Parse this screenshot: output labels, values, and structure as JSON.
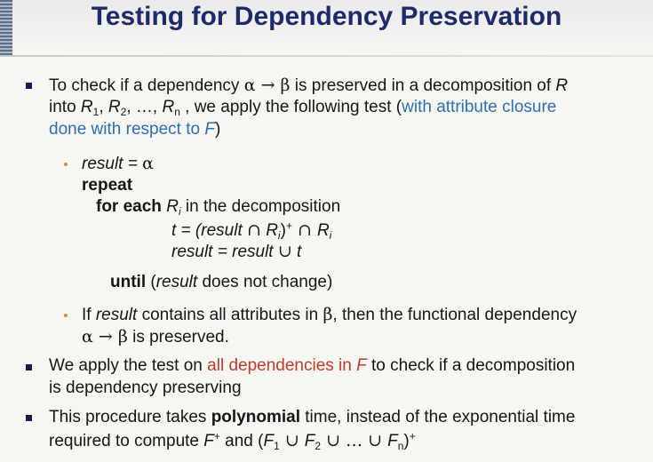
{
  "slide": {
    "title": "Testing for Dependency Preservation"
  },
  "b1": {
    "l1_a": "To check if a dependency ",
    "alpha": "α",
    "arrow": " → ",
    "beta": "β",
    "l1_b": " is preserved in a decomposition of ",
    "R": "R",
    "l2_into": "into ",
    "R1": "R",
    "sub1": "1",
    "c1": ", ",
    "R2": "R",
    "sub2": "2",
    "c2": ", …, ",
    "Rn": "R",
    "subn": "n",
    "l2_b": " , we apply the following test (",
    "l2_blue": "with attribute closure",
    "l3_blue": "done with respect to ",
    "F": "F",
    "close": ")"
  },
  "alg": {
    "result_init": "result = ",
    "alpha": "α",
    "repeat": "repeat",
    "for_each": "for each ",
    "Ri": "R",
    "i": "i",
    "in_decomp": " in the decomposition",
    "t_eq": "t = (result ",
    "cap": "∩",
    "Ri2": " R",
    "i2": "i",
    "plus_close": ")",
    "plus": "+",
    "cap2": " ∩ ",
    "Ri3": "R",
    "i3": "i",
    "result_eq": "result  =  result  ",
    "cup": "∪",
    "t": " t",
    "until": "until",
    "until_a": "  (",
    "until_result": "result",
    "until_b": " does not change)"
  },
  "sub2": {
    "a": "If ",
    "result": "result",
    "b": " contains all attributes in ",
    "beta": "β",
    "c": ", then the functional dependency",
    "alpha": "α",
    "arrow": " → ",
    "beta2": "β",
    "d": " is preserved."
  },
  "b2": {
    "a": "We apply the test on ",
    "red": "all dependencies in ",
    "F": "F",
    "b": "  to check if a decomposition",
    "c": "is dependency preserving"
  },
  "b3": {
    "a": "This procedure takes ",
    "bold": "polynomial",
    "b": " time, instead of the exponential time",
    "c": "required to compute ",
    "F": "F",
    "plus": "+",
    "d": " and (",
    "F1": "F",
    "s1": "1",
    "cup1": " ∪ ",
    "F2": "F",
    "s2": "2",
    "cup2": " ∪ … ∪ ",
    "Fn": "F",
    "sn": "n",
    "e": ")",
    "plus2": "+"
  }
}
